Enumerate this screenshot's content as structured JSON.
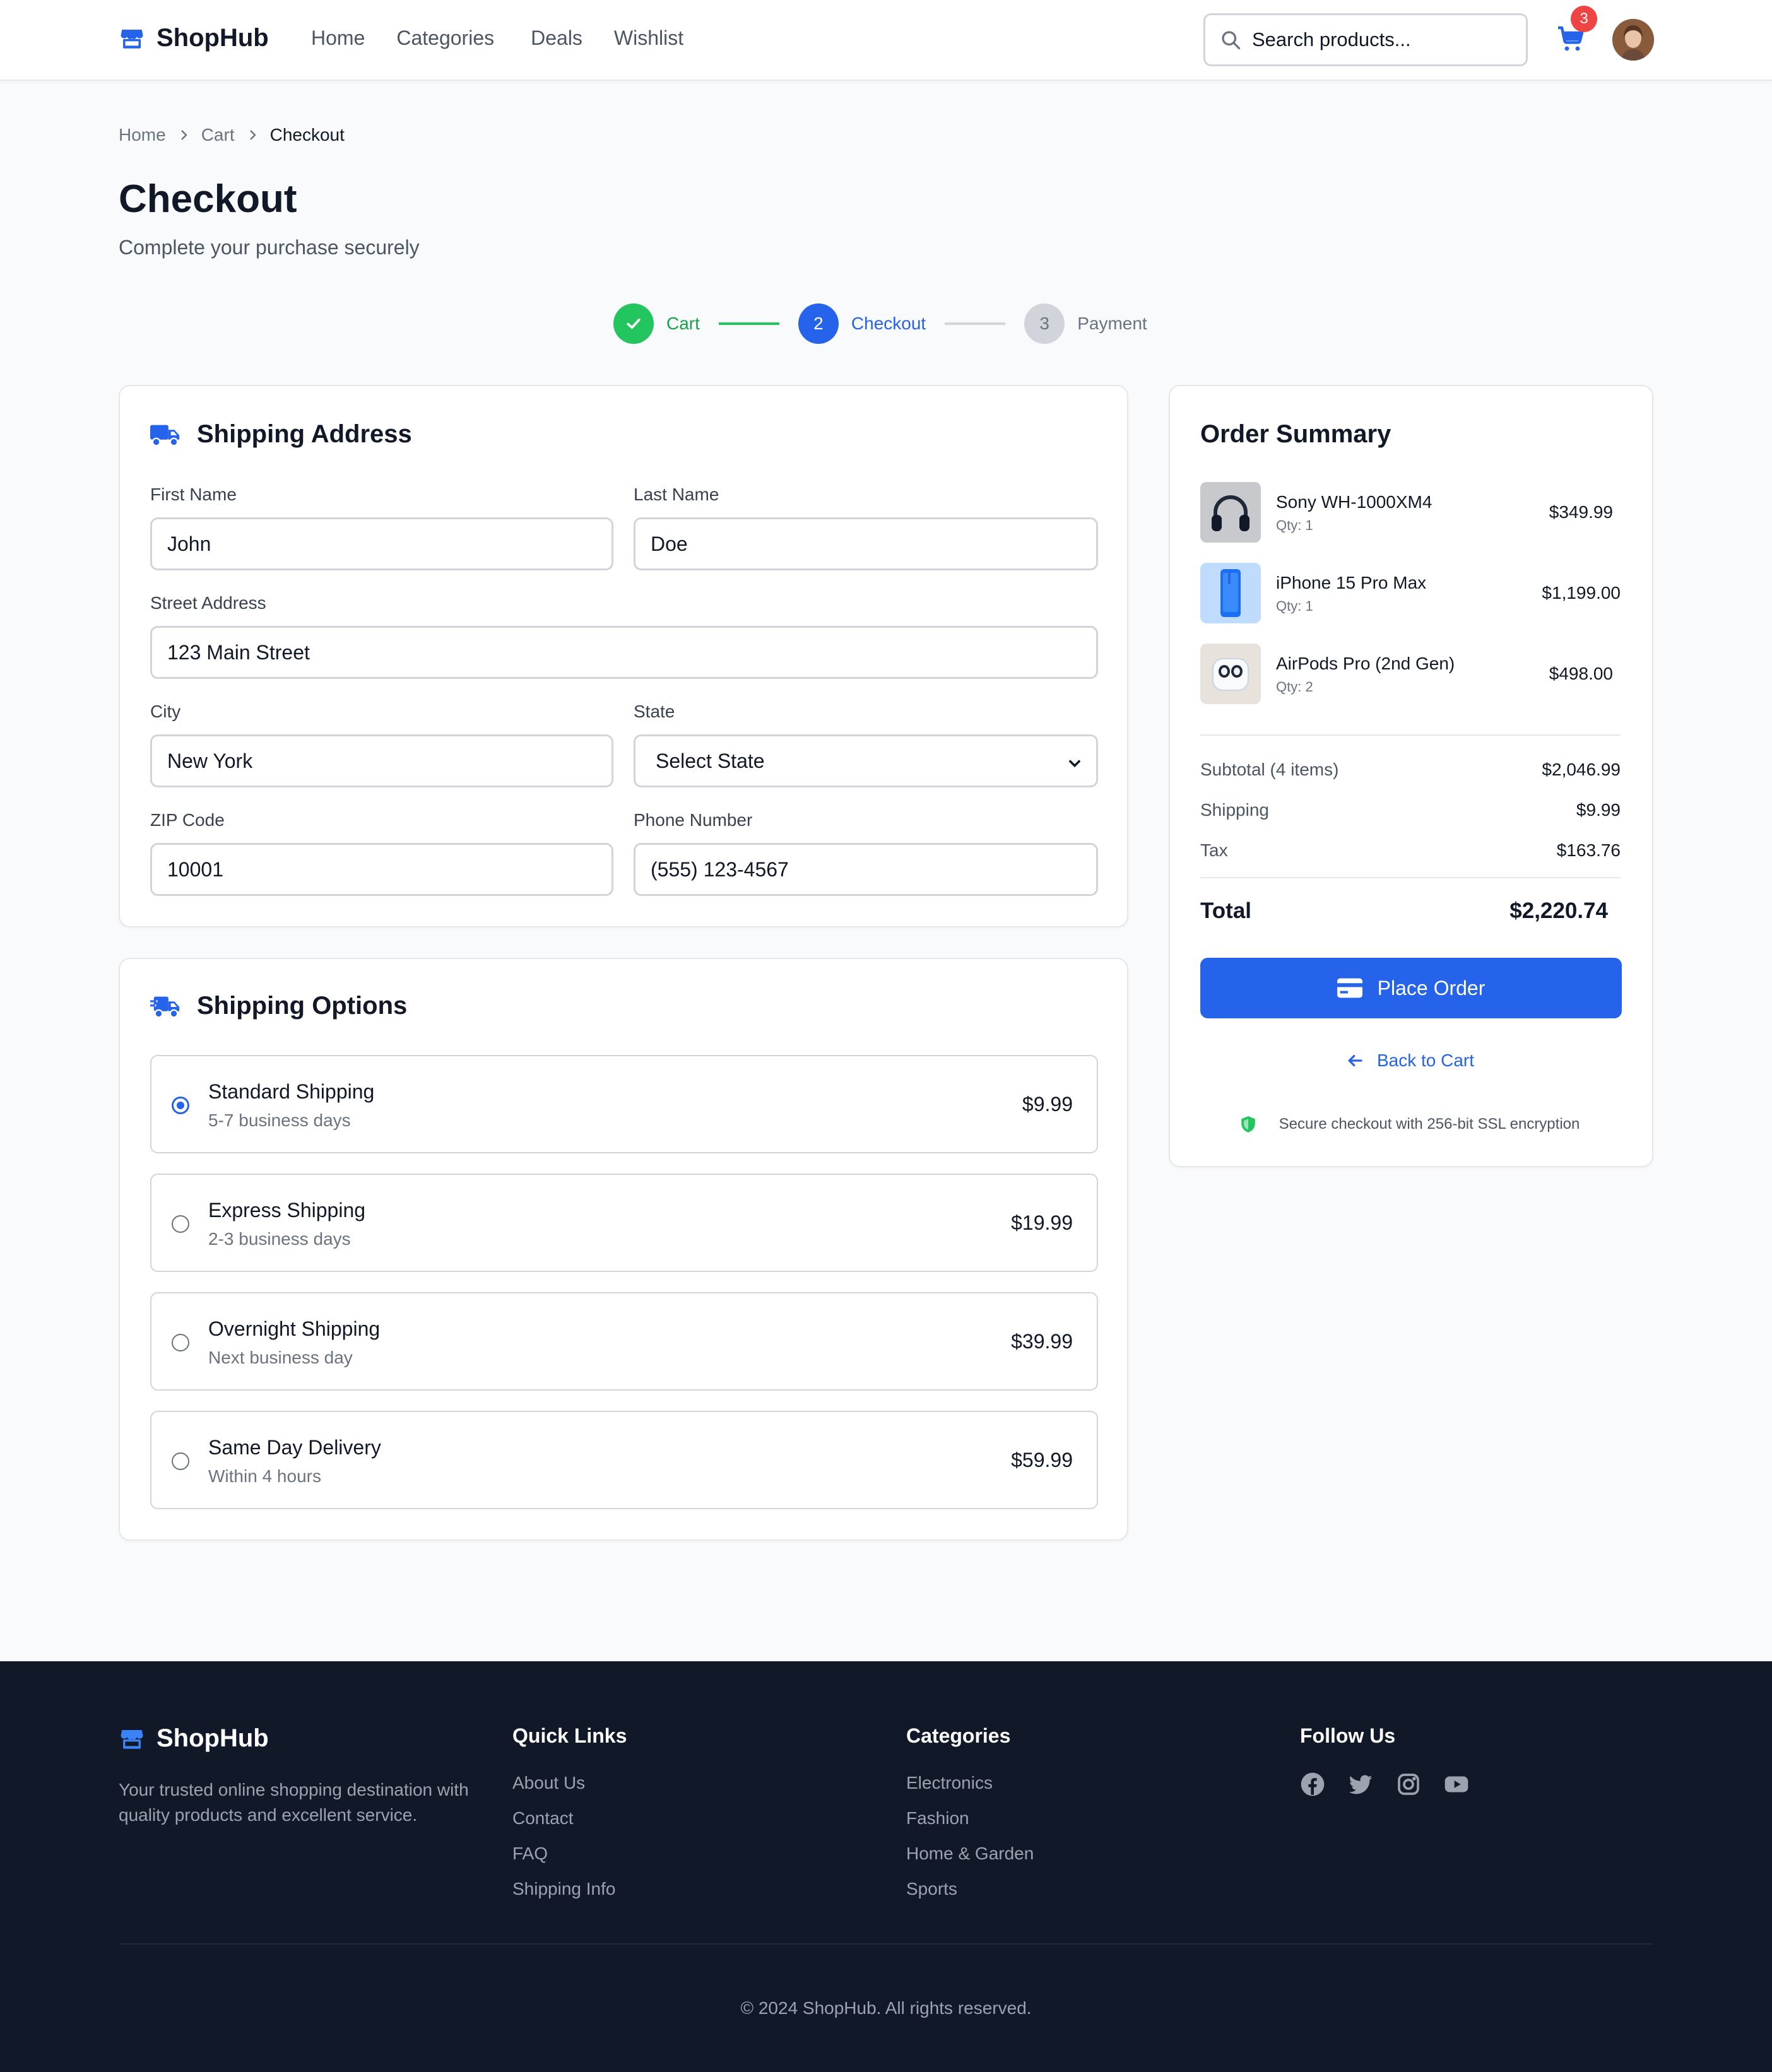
{
  "app": {
    "name": "ShopHub"
  },
  "nav": {
    "items": [
      "Home",
      "Categories",
      "Deals",
      "Wishlist"
    ]
  },
  "search": {
    "placeholder": "Search products..."
  },
  "cart": {
    "count": "3"
  },
  "breadcrumb": {
    "items": [
      "Home",
      "Cart",
      "Checkout"
    ]
  },
  "page": {
    "title": "Checkout",
    "subtitle": "Complete your purchase securely"
  },
  "stepper": {
    "steps": [
      {
        "label": "Cart",
        "number": "",
        "state": "done"
      },
      {
        "label": "Checkout",
        "number": "2",
        "state": "active"
      },
      {
        "label": "Payment",
        "number": "3",
        "state": "pending"
      }
    ]
  },
  "shipping_address": {
    "title": "Shipping Address",
    "first_name": {
      "label": "First Name",
      "value": "John"
    },
    "last_name": {
      "label": "Last Name",
      "value": "Doe"
    },
    "street": {
      "label": "Street Address",
      "value": "123 Main Street"
    },
    "city": {
      "label": "City",
      "value": "New York"
    },
    "state": {
      "label": "State",
      "value": "Select State"
    },
    "zip": {
      "label": "ZIP Code",
      "value": "10001"
    },
    "phone": {
      "label": "Phone Number",
      "value": "(555) 123-4567"
    }
  },
  "shipping_options": {
    "title": "Shipping Options",
    "selected": 0,
    "options": [
      {
        "name": "Standard Shipping",
        "sub": "5-7 business days",
        "price": "$9.99"
      },
      {
        "name": "Express Shipping",
        "sub": "2-3 business days",
        "price": "$19.99"
      },
      {
        "name": "Overnight Shipping",
        "sub": "Next business day",
        "price": "$39.99"
      },
      {
        "name": "Same Day Delivery",
        "sub": "Within 4 hours",
        "price": "$59.99"
      }
    ]
  },
  "order_summary": {
    "title": "Order Summary",
    "items": [
      {
        "name": "Sony WH-1000XM4",
        "qty": "Qty: 1",
        "price": "$349.99",
        "thumb": "headphones"
      },
      {
        "name": "iPhone 15 Pro Max",
        "qty": "Qty: 1",
        "price": "$1,199.00",
        "thumb": "phone"
      },
      {
        "name": "AirPods Pro (2nd Gen)",
        "qty": "Qty: 2",
        "price": "$498.00",
        "thumb": "earbuds"
      }
    ],
    "subtotal_label": "Subtotal (4 items)",
    "subtotal": "$2,046.99",
    "shipping_label": "Shipping",
    "shipping": "$9.99",
    "tax_label": "Tax",
    "tax": "$163.76",
    "total_label": "Total",
    "total": "$2,220.74",
    "place_order": "Place Order",
    "back_to_cart": "Back to Cart",
    "secure_note": "Secure checkout with 256-bit SSL encryption"
  },
  "footer": {
    "brand": "ShopHub",
    "description": "Your trusted online shopping destination with quality products and excellent service.",
    "quick_links": {
      "title": "Quick Links",
      "items": [
        "About Us",
        "Contact",
        "FAQ",
        "Shipping Info"
      ]
    },
    "categories": {
      "title": "Categories",
      "items": [
        "Electronics",
        "Fashion",
        "Home & Garden",
        "Sports"
      ]
    },
    "follow": {
      "title": "Follow Us",
      "icons": [
        "facebook-icon",
        "twitter-icon",
        "instagram-icon",
        "youtube-icon"
      ]
    },
    "copyright": "© 2024 ShopHub. All rights reserved."
  },
  "colors": {
    "primary": "#2563eb",
    "success": "#22c55e",
    "danger": "#ef4444",
    "footer_bg": "#111827"
  }
}
